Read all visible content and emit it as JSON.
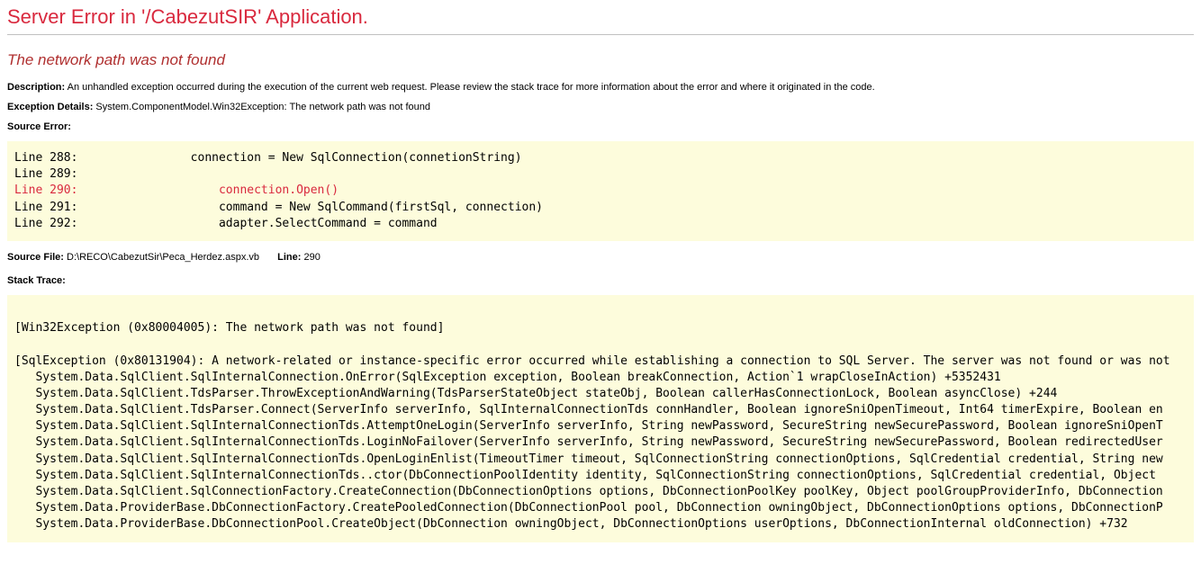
{
  "header": {
    "title": "Server Error in '/CabezutSIR' Application."
  },
  "error": {
    "subtitle": "The network path was not found",
    "description_label": "Description:",
    "description_text": "An unhandled exception occurred during the execution of the current web request. Please review the stack trace for more information about the error and where it originated in the code.",
    "exception_label": "Exception Details:",
    "exception_text": "System.ComponentModel.Win32Exception: The network path was not found",
    "source_error_label": "Source Error:",
    "source_lines": {
      "l288": "Line 288:                connection = New SqlConnection(connetionString)",
      "l289": "Line 289:",
      "l290": "Line 290:                    connection.Open()",
      "l291": "Line 291:                    command = New SqlCommand(firstSql, connection)",
      "l292": "Line 292:                    adapter.SelectCommand = command"
    },
    "source_file_label": "Source File:",
    "source_file": "D:\\RECO\\CabezutSir\\Peca_Herdez.aspx.vb",
    "line_label": "Line:",
    "line_number": "290",
    "stack_trace_label": "Stack Trace:",
    "stack_trace": "\n[Win32Exception (0x80004005): The network path was not found]\n\n[SqlException (0x80131904): A network-related or instance-specific error occurred while establishing a connection to SQL Server. The server was not found or was not\n   System.Data.SqlClient.SqlInternalConnection.OnError(SqlException exception, Boolean breakConnection, Action`1 wrapCloseInAction) +5352431\n   System.Data.SqlClient.TdsParser.ThrowExceptionAndWarning(TdsParserStateObject stateObj, Boolean callerHasConnectionLock, Boolean asyncClose) +244\n   System.Data.SqlClient.TdsParser.Connect(ServerInfo serverInfo, SqlInternalConnectionTds connHandler, Boolean ignoreSniOpenTimeout, Int64 timerExpire, Boolean en\n   System.Data.SqlClient.SqlInternalConnectionTds.AttemptOneLogin(ServerInfo serverInfo, String newPassword, SecureString newSecurePassword, Boolean ignoreSniOpenT\n   System.Data.SqlClient.SqlInternalConnectionTds.LoginNoFailover(ServerInfo serverInfo, String newPassword, SecureString newSecurePassword, Boolean redirectedUser\n   System.Data.SqlClient.SqlInternalConnectionTds.OpenLoginEnlist(TimeoutTimer timeout, SqlConnectionString connectionOptions, SqlCredential credential, String new\n   System.Data.SqlClient.SqlInternalConnectionTds..ctor(DbConnectionPoolIdentity identity, SqlConnectionString connectionOptions, SqlCredential credential, Object \n   System.Data.SqlClient.SqlConnectionFactory.CreateConnection(DbConnectionOptions options, DbConnectionPoolKey poolKey, Object poolGroupProviderInfo, DbConnection\n   System.Data.ProviderBase.DbConnectionFactory.CreatePooledConnection(DbConnectionPool pool, DbConnection owningObject, DbConnectionOptions options, DbConnectionP\n   System.Data.ProviderBase.DbConnectionPool.CreateObject(DbConnection owningObject, DbConnectionOptions userOptions, DbConnectionInternal oldConnection) +732"
  }
}
